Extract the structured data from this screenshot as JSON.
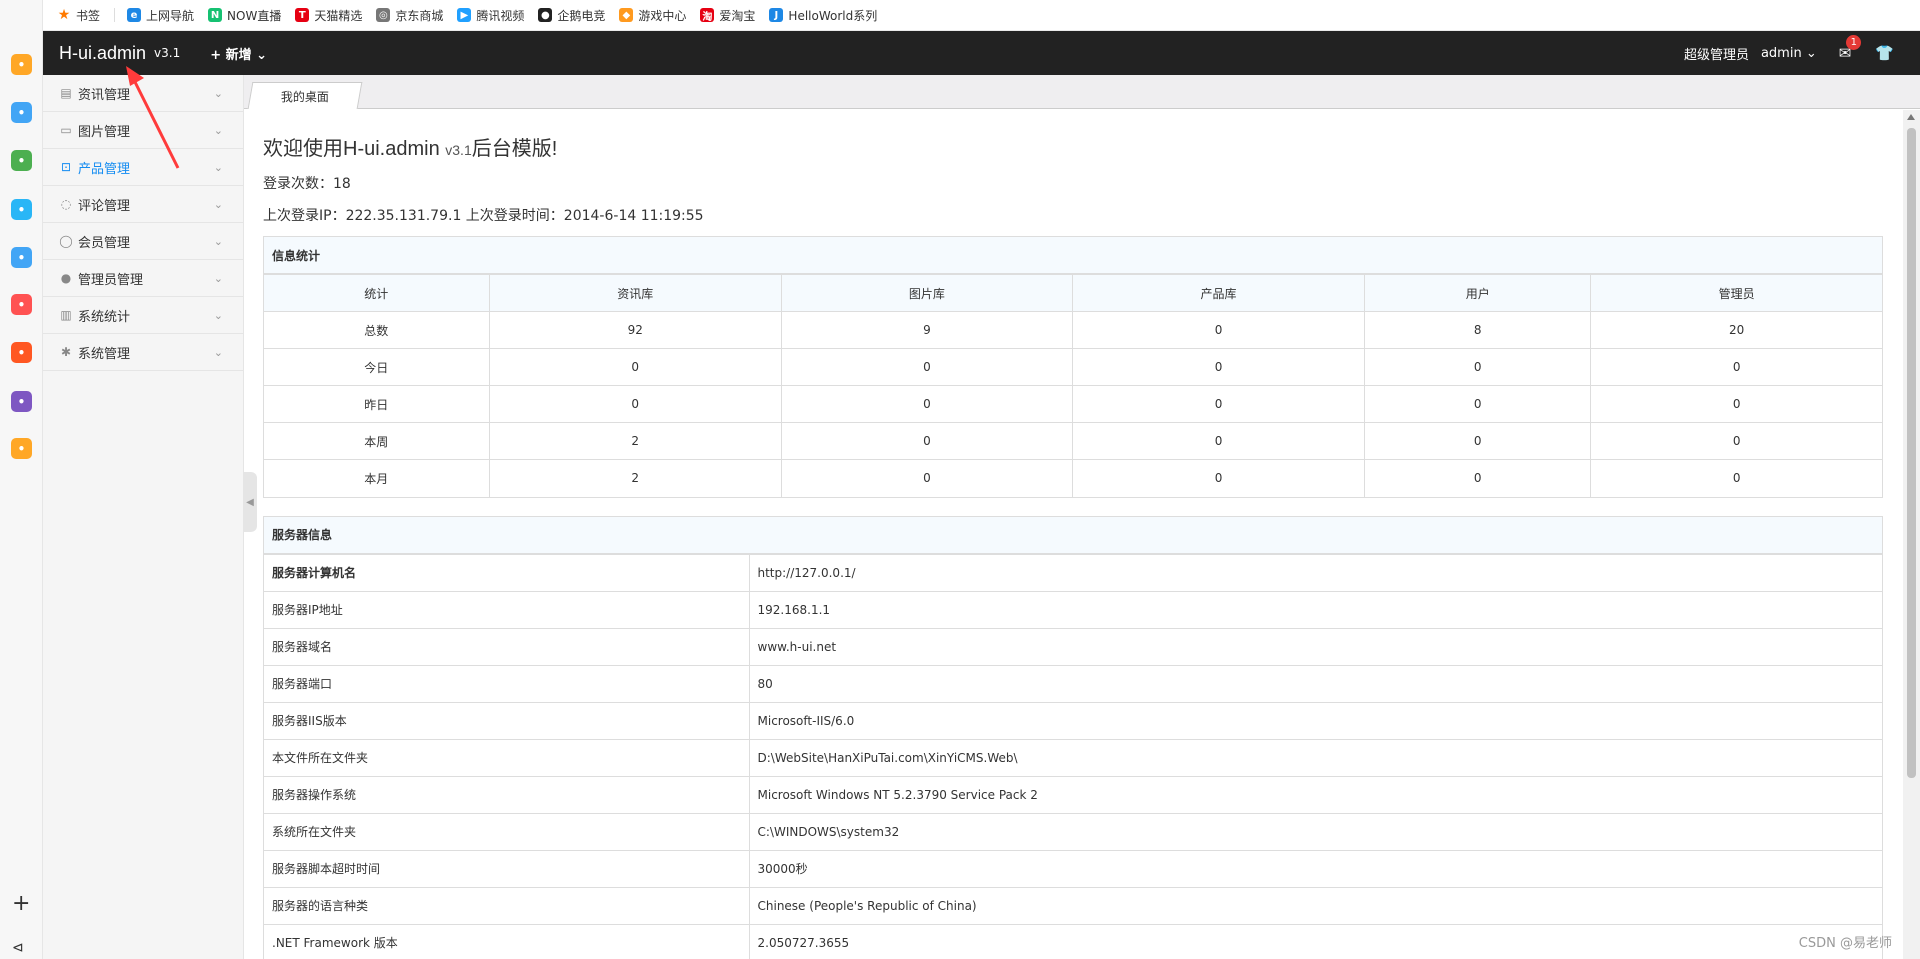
{
  "bookmarks": [
    {
      "label": "书签",
      "icon": "star-icon",
      "color": "#ff7a00"
    },
    {
      "label": "上网导航",
      "icon": "ie-icon",
      "color": "#1e88e5"
    },
    {
      "label": "NOW直播",
      "icon": "now-icon",
      "color": "#16c172"
    },
    {
      "label": "天猫精选",
      "icon": "tmall-icon",
      "color": "#e60012"
    },
    {
      "label": "京东商城",
      "icon": "globe-icon",
      "color": "#777777"
    },
    {
      "label": "腾讯视频",
      "icon": "video-icon",
      "color": "#20a0ff"
    },
    {
      "label": "企鹅电竞",
      "icon": "penguin-icon",
      "color": "#222222"
    },
    {
      "label": "游戏中心",
      "icon": "gamepad-icon",
      "color": "#ff9a1f"
    },
    {
      "label": "爱淘宝",
      "icon": "taobao-icon",
      "color": "#e60012"
    },
    {
      "label": "HelloWorld系列",
      "icon": "j-icon",
      "color": "#1e88e5"
    }
  ],
  "navbar": {
    "logo": "H-ui.admin",
    "version": "v3.1",
    "add_label": "+ 新增 ⌄",
    "role": "超级管理员",
    "user": "admin ⌄",
    "message_count": "1"
  },
  "sidebar": {
    "items": [
      {
        "label": "资讯管理",
        "icon": "news-icon",
        "active": false
      },
      {
        "label": "图片管理",
        "icon": "picture-icon",
        "active": false
      },
      {
        "label": "产品管理",
        "icon": "bag-icon",
        "active": true
      },
      {
        "label": "评论管理",
        "icon": "comment-icon",
        "active": false
      },
      {
        "label": "会员管理",
        "icon": "user-icon",
        "active": false
      },
      {
        "label": "管理员管理",
        "icon": "admin-icon",
        "active": false
      },
      {
        "label": "系统统计",
        "icon": "chart-icon",
        "active": false
      },
      {
        "label": "系统管理",
        "icon": "gear-icon",
        "active": false
      }
    ]
  },
  "tabs": {
    "current": "我的桌面"
  },
  "main": {
    "welcome": "欢迎使用H-ui.admin",
    "welcome_version": "v3.1",
    "welcome_suffix": "后台模版!",
    "login_count": "登录次数：18",
    "last_login": "上次登录IP：222.35.131.79.1  上次登录时间：2014-6-14 11:19:55"
  },
  "stats": {
    "title": "信息统计",
    "headers": [
      "统计",
      "资讯库",
      "图片库",
      "产品库",
      "用户",
      "管理员"
    ],
    "rows": [
      [
        "总数",
        "92",
        "9",
        "0",
        "8",
        "20"
      ],
      [
        "今日",
        "0",
        "0",
        "0",
        "0",
        "0"
      ],
      [
        "昨日",
        "0",
        "0",
        "0",
        "0",
        "0"
      ],
      [
        "本周",
        "2",
        "0",
        "0",
        "0",
        "0"
      ],
      [
        "本月",
        "2",
        "0",
        "0",
        "0",
        "0"
      ]
    ]
  },
  "server": {
    "title": "服务器信息",
    "rows": [
      [
        "服务器计算机名",
        "http://127.0.0.1/"
      ],
      [
        "服务器IP地址",
        "192.168.1.1"
      ],
      [
        "服务器域名",
        "www.h-ui.net"
      ],
      [
        "服务器端口",
        "80"
      ],
      [
        "服务器IIS版本",
        "Microsoft-IIS/6.0"
      ],
      [
        "本文件所在文件夹",
        "D:\\WebSite\\HanXiPuTai.com\\XinYiCMS.Web\\"
      ],
      [
        "服务器操作系统",
        "Microsoft Windows NT 5.2.3790 Service Pack 2"
      ],
      [
        "系统所在文件夹",
        "C:\\WINDOWS\\system32"
      ],
      [
        "服务器脚本超时时间",
        "30000秒"
      ],
      [
        "服务器的语言种类",
        "Chinese (People's Republic of China)"
      ],
      [
        ".NET Framework 版本",
        "2.050727.3655"
      ]
    ]
  },
  "watermark": "CSDN @易老师",
  "dock": {
    "icons": [
      {
        "name": "favorites-icon",
        "color": "#ffa726"
      },
      {
        "name": "clock-icon",
        "color": "#42a5f5"
      },
      {
        "name": "wechat-icon",
        "color": "#4caf50"
      },
      {
        "name": "pinwheel-icon",
        "color": "#29b6f6"
      },
      {
        "name": "cloud-icon",
        "color": "#42a5f5"
      },
      {
        "name": "photo-icon",
        "color": "#ff5252"
      },
      {
        "name": "pdf-icon",
        "color": "#ff5722"
      },
      {
        "name": "edit-icon",
        "color": "#7e57c2"
      },
      {
        "name": "search-icon",
        "color": "#ffa726"
      }
    ]
  }
}
